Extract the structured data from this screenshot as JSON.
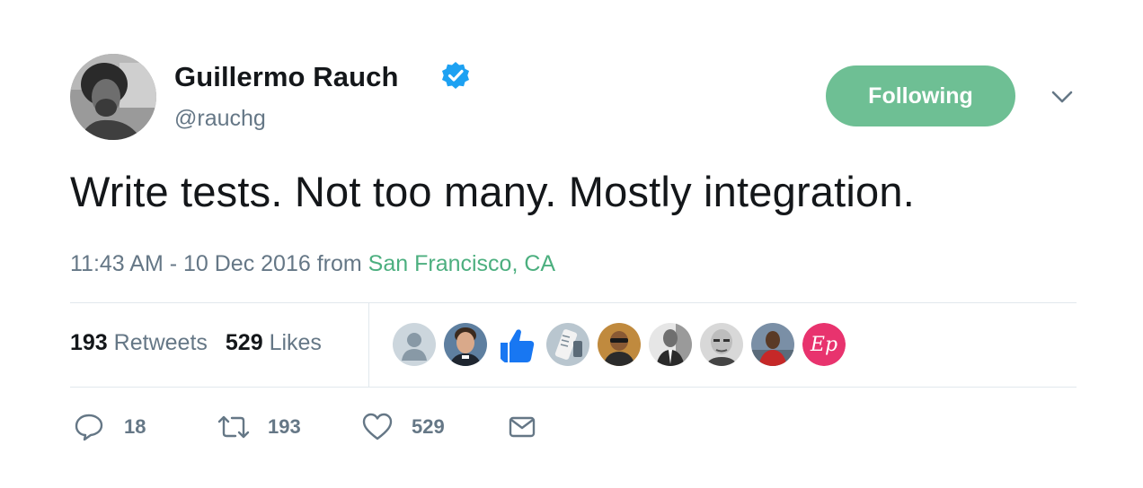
{
  "author": {
    "name": "Guillermo Rauch",
    "handle": "@rauchg",
    "verified_icon": "verified-badge-icon"
  },
  "follow_button": {
    "label": "Following",
    "color": "#6ebf94"
  },
  "tweet": {
    "text": "Write tests. Not too many. Mostly integration.",
    "time": "11:43 AM - 10 Dec 2016 from",
    "location": "San Francisco, CA"
  },
  "stats": {
    "retweets_count": "193",
    "retweets_label": "Retweets",
    "likes_count": "529",
    "likes_label": "Likes"
  },
  "likers": [
    "default-avatar",
    "user-avatar",
    "thumbs-up-avatar",
    "user-avatar",
    "user-avatar",
    "user-avatar",
    "user-avatar",
    "user-avatar",
    "ep-logo-avatar"
  ],
  "actions": {
    "reply_count": "18",
    "retweet_count": "193",
    "like_count": "529"
  },
  "colors": {
    "text": "#14171a",
    "muted": "#657786",
    "location": "#4caf7f",
    "verified": "#1da1f2",
    "divider": "#e1e8ed"
  }
}
